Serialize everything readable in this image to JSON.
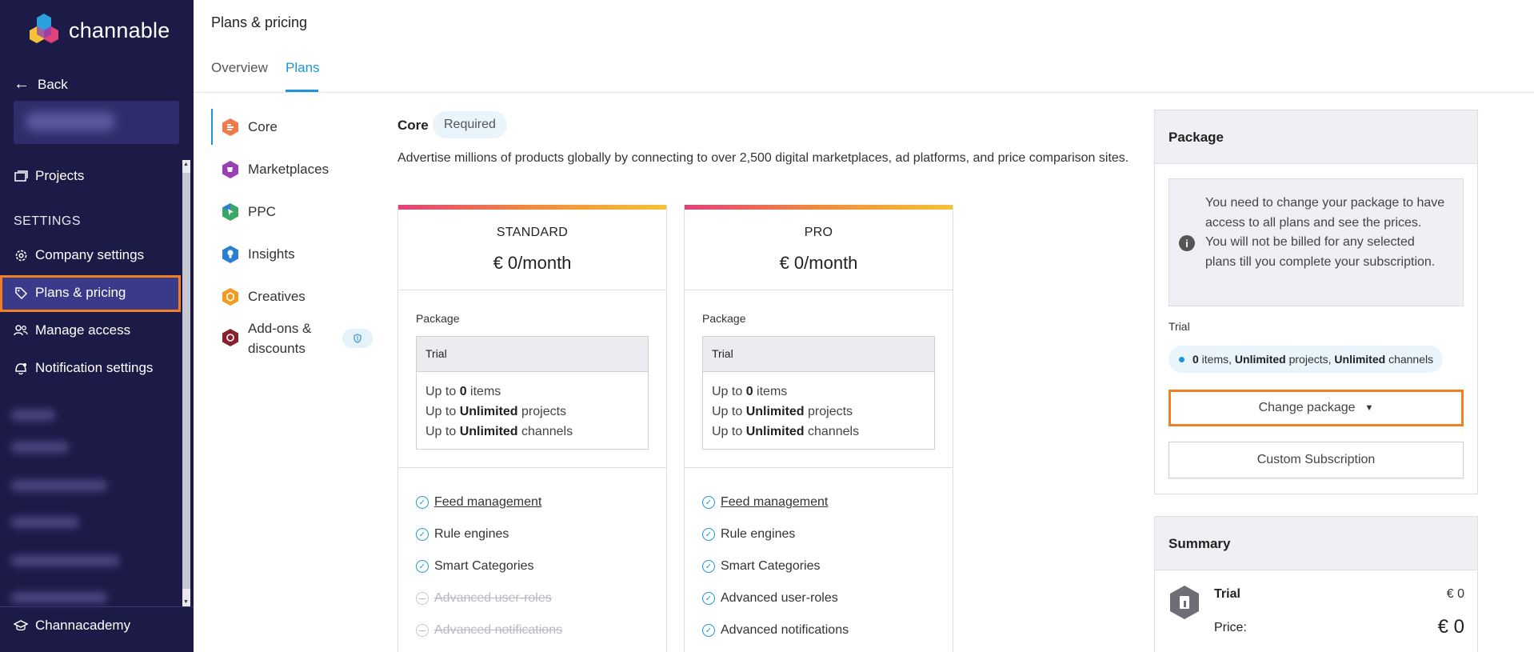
{
  "sidebar": {
    "brand": "channable",
    "back_label": "Back",
    "projects_label": "Projects",
    "settings_heading": "SETTINGS",
    "company_settings": "Company settings",
    "plans_pricing": "Plans & pricing",
    "manage_access": "Manage access",
    "notification_settings": "Notification settings",
    "channacademy": "Channacademy"
  },
  "header": {
    "title": "Plans & pricing",
    "tabs": [
      {
        "label": "Overview"
      },
      {
        "label": "Plans"
      }
    ]
  },
  "plans_nav": [
    {
      "label": "Core",
      "icon": "core-icon",
      "color": "#f07a4a"
    },
    {
      "label": "Marketplaces",
      "icon": "marketplaces-icon",
      "color": "#9b3fb5"
    },
    {
      "label": "PPC",
      "icon": "ppc-icon",
      "color": "#3aa66a"
    },
    {
      "label": "Insights",
      "icon": "insights-icon",
      "color": "#2a7fd0"
    },
    {
      "label": "Creatives",
      "icon": "creatives-icon",
      "color": "#f29a1e"
    },
    {
      "label_line1": "Add-ons &",
      "label_line2": "discounts",
      "icon": "addons-icon",
      "color": "#8a1f2e"
    }
  ],
  "main": {
    "section_title": "Core",
    "required_badge": "Required",
    "description": "Advertise millions of products globally by connecting to over 2,500 digital marketplaces, ad platforms, and price comparison sites.",
    "cards": [
      {
        "name": "STANDARD",
        "price": "€ 0/month",
        "package_label": "Package",
        "package_name": "Trial",
        "items_prefix": "Up to ",
        "items_value": "0",
        "items_suffix": " items",
        "projects_prefix": "Up to ",
        "projects_value": "Unlimited",
        "projects_suffix": " projects",
        "channels_prefix": "Up to ",
        "channels_value": "Unlimited",
        "channels_suffix": " channels",
        "features": [
          {
            "label": "Feed management",
            "included": true
          },
          {
            "label": "Rule engines",
            "included": true
          },
          {
            "label": "Smart Categories",
            "included": true
          },
          {
            "label": "Advanced user-roles",
            "included": false
          },
          {
            "label": "Advanced notifications",
            "included": false
          }
        ]
      },
      {
        "name": "PRO",
        "price": "€ 0/month",
        "package_label": "Package",
        "package_name": "Trial",
        "items_prefix": "Up to ",
        "items_value": "0",
        "items_suffix": " items",
        "projects_prefix": "Up to ",
        "projects_value": "Unlimited",
        "projects_suffix": " projects",
        "channels_prefix": "Up to ",
        "channels_value": "Unlimited",
        "channels_suffix": " channels",
        "features": [
          {
            "label": "Feed management",
            "included": true
          },
          {
            "label": "Rule engines",
            "included": true
          },
          {
            "label": "Smart Categories",
            "included": true
          },
          {
            "label": "Advanced user-roles",
            "included": true
          },
          {
            "label": "Advanced notifications",
            "included": true
          }
        ]
      }
    ]
  },
  "package_panel": {
    "title": "Package",
    "info_text": "You need to change your package to have access to all plans and see the prices. You will not be billed for any selected plans till you complete your subscription.",
    "trial_label": "Trial",
    "trial_items_value": "0",
    "trial_items_suffix": " items, ",
    "trial_projects_value": "Unlimited",
    "trial_projects_suffix": " projects, ",
    "trial_channels_value": "Unlimited",
    "trial_channels_suffix": " channels",
    "change_package": "Change package",
    "custom_subscription": "Custom Subscription"
  },
  "summary_panel": {
    "title": "Summary",
    "trial_label": "Trial",
    "trial_value": "€ 0",
    "price_label": "Price:",
    "price_value": "€ 0"
  },
  "colors": {
    "sidebar_bg": "#1c1a47",
    "accent": "#1c96d6",
    "highlight": "#f27f24"
  }
}
